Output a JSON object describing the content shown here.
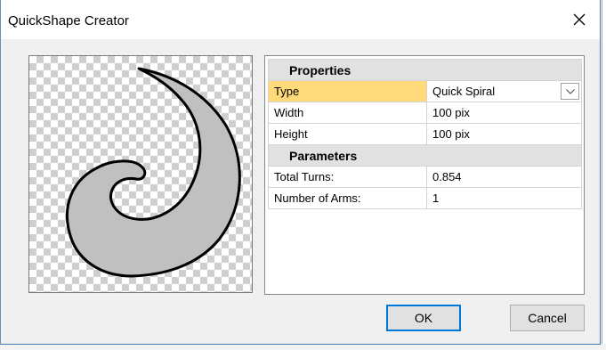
{
  "window": {
    "title": "QuickShape Creator"
  },
  "properties": {
    "section_title": "Properties",
    "rows": [
      {
        "label": "Type",
        "value": "Quick Spiral",
        "control": "dropdown",
        "selected": true
      },
      {
        "label": "Width",
        "value": "100 pix"
      },
      {
        "label": "Height",
        "value": "100 pix"
      }
    ]
  },
  "parameters": {
    "section_title": "Parameters",
    "rows": [
      {
        "label": "Total Turns:",
        "value": "0.854"
      },
      {
        "label": "Number of Arms:",
        "value": "1"
      }
    ]
  },
  "buttons": {
    "ok": "OK",
    "cancel": "Cancel"
  },
  "icons": {
    "close": "close-icon",
    "dropdown": "chevron-down-icon"
  },
  "colors": {
    "selected_row": "#ffd97a",
    "section_header": "#e1e1e1",
    "default_button_border": "#0078d7",
    "shape_fill": "#c0c0c0"
  }
}
